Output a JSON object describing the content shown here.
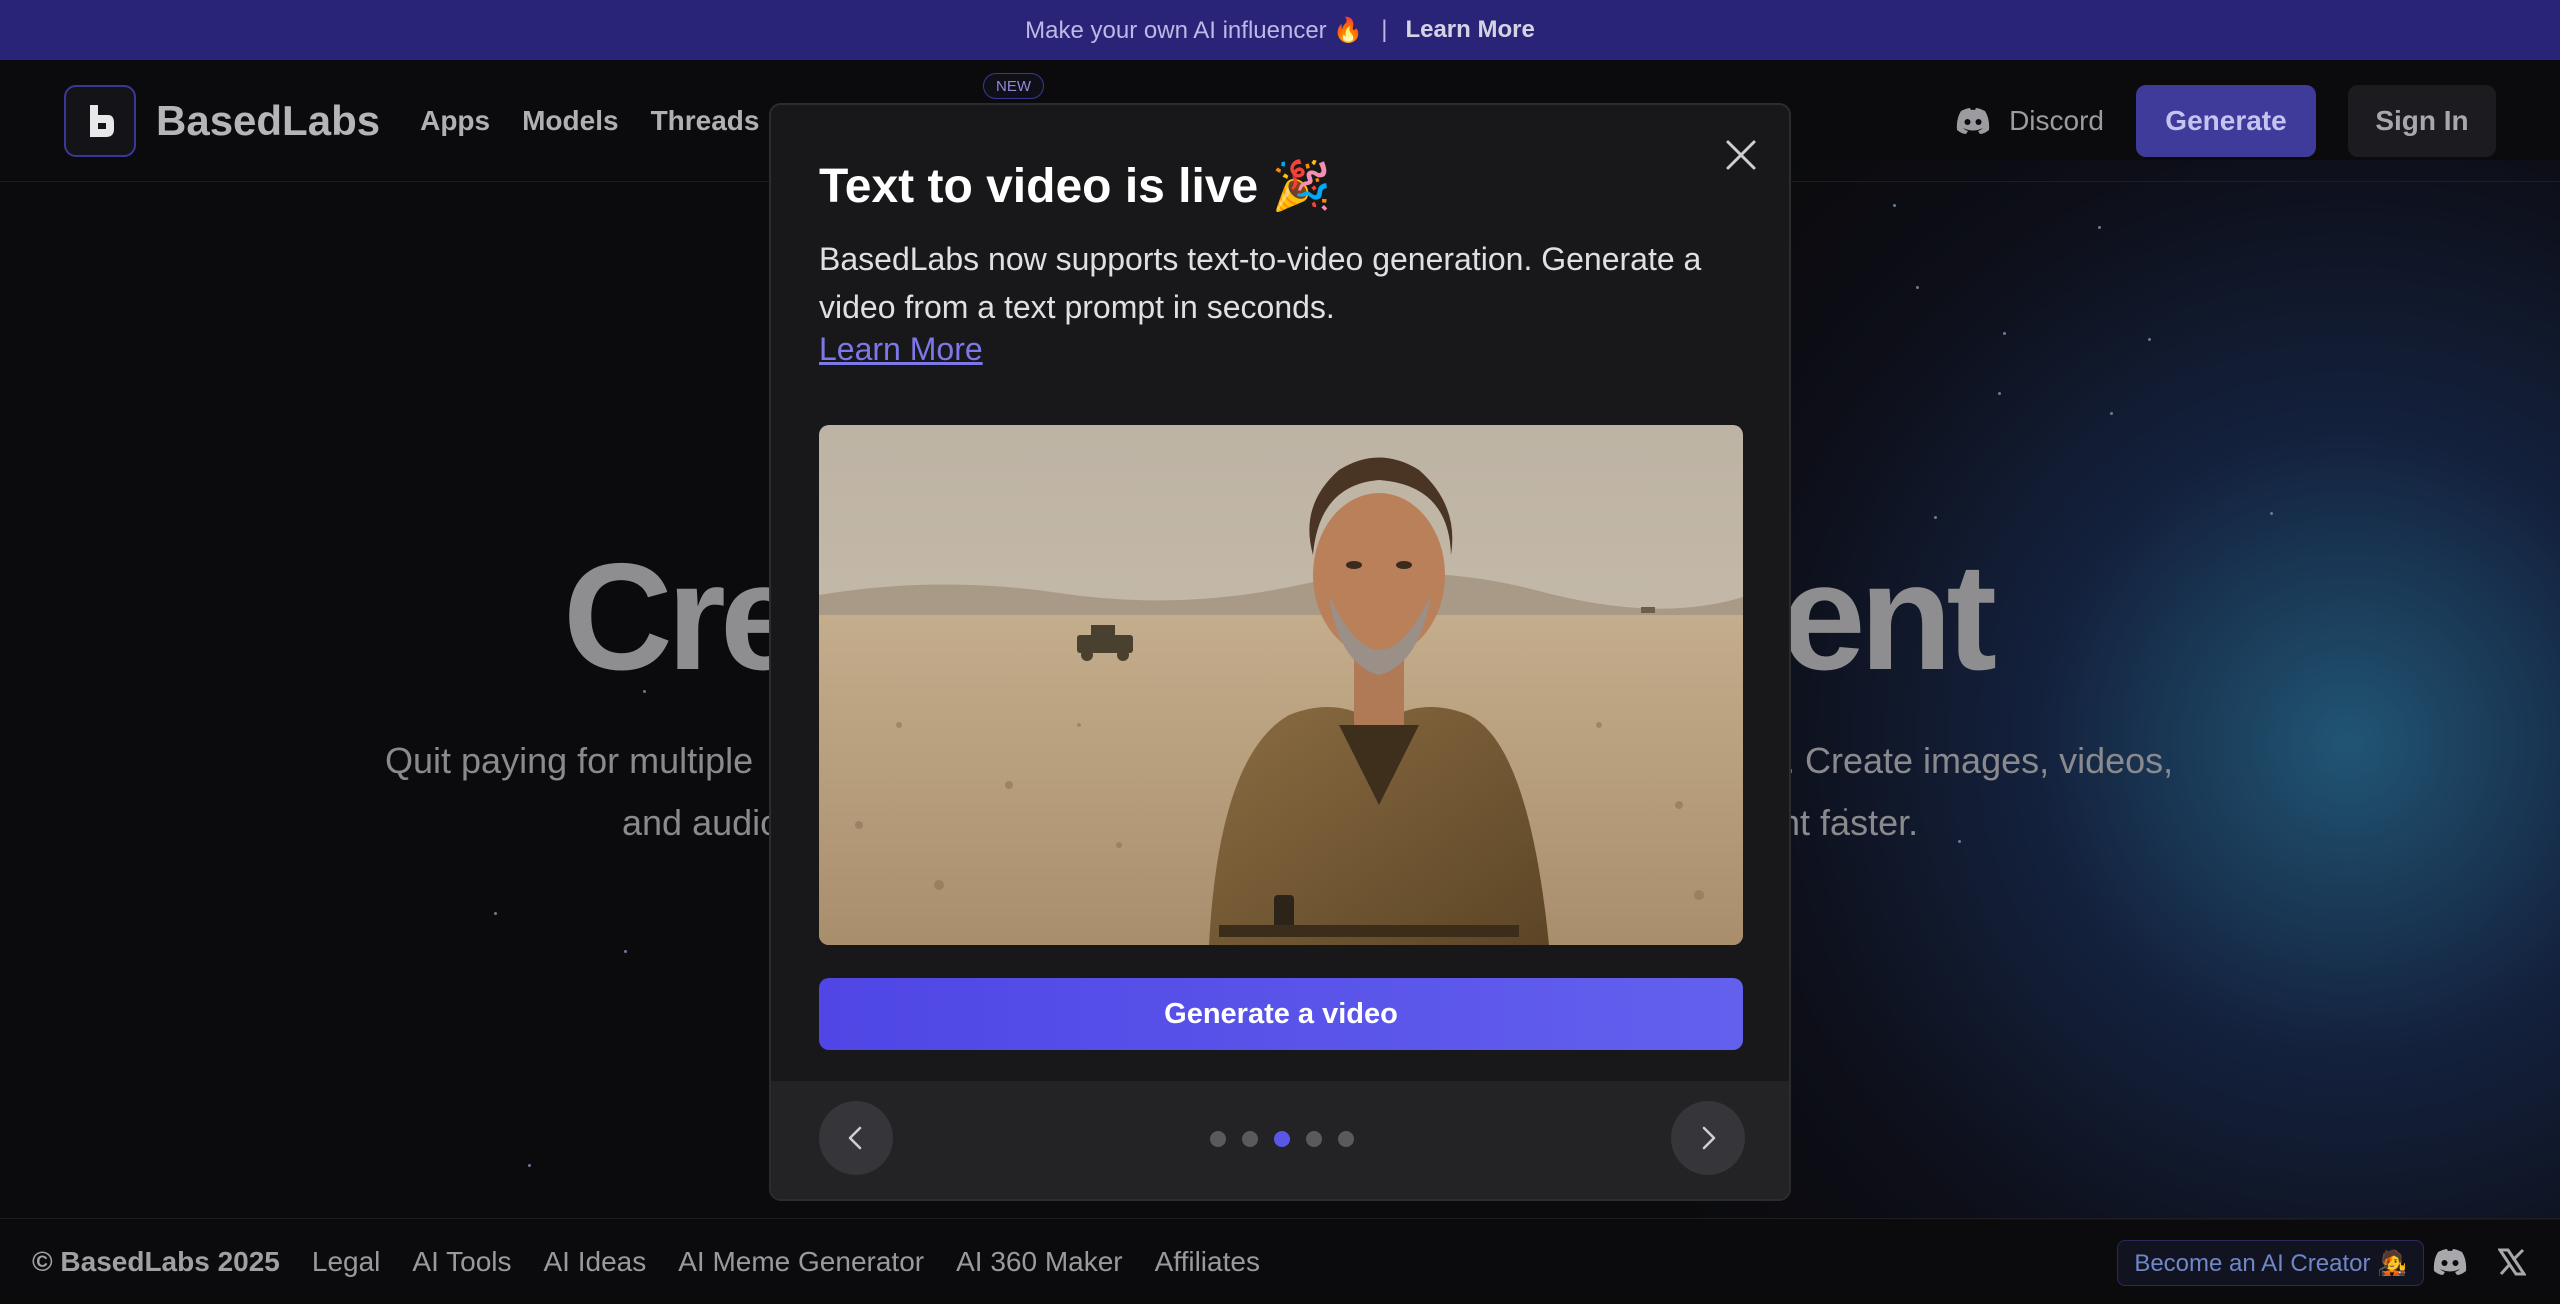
{
  "announcement": {
    "text": "Make your own AI influencer 🔥",
    "separator": "|",
    "link_label": "Learn More"
  },
  "navbar": {
    "brand": "BasedLabs",
    "links": [
      "Apps",
      "Models",
      "Threads"
    ],
    "new_badge": "NEW",
    "discord_label": "Discord",
    "generate_label": "Generate",
    "signin_label": "Sign In"
  },
  "hero": {
    "headline_left": "Cre",
    "headline_right": "ent",
    "sub_line1_left": "Quit paying for multiple",
    "sub_line1_right": ". Create images, videos,",
    "sub_line2_left": "and audio",
    "sub_line2_right": "ent faster."
  },
  "modal": {
    "title": "Text to video is live 🎉",
    "description": "BasedLabs now supports text-to-video generation. Generate a video from a text prompt in seconds.",
    "learn_more": "Learn More",
    "cta_label": "Generate a video",
    "dots": {
      "count": 5,
      "active_index": 2
    }
  },
  "footer": {
    "copyright": "© BasedLabs 2025",
    "links": [
      "Legal",
      "AI Tools",
      "AI Ideas",
      "AI Meme Generator",
      "AI 360 Maker",
      "Affiliates"
    ],
    "creator_cta": "Become an AI Creator 🧑‍🎤"
  },
  "colors": {
    "accent": "#4f46e5",
    "announce_bg": "#2a2478",
    "modal_bg": "#18181b"
  }
}
